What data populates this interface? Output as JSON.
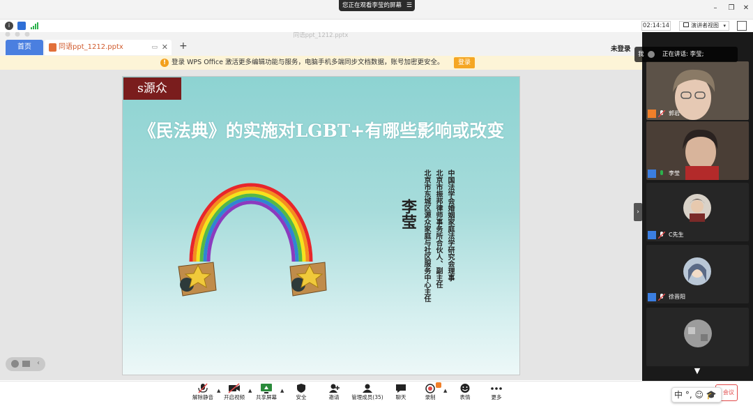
{
  "meeting": {
    "share_banner": "您正在观看李莹的屏幕",
    "timer": "02:14:14",
    "view_mode": "演讲者视图"
  },
  "wps": {
    "home_tab": "首页",
    "file_tab": "同语ppt_1212.pptx",
    "window_title": "同语ppt_1212.pptx",
    "new_tab": "+",
    "login_status": "未登录",
    "notice": "登录 WPS Office 激活更多编辑功能与服务，电脑手机多端同步文档数据，账号加密更安全。",
    "login_button": "登录"
  },
  "slide": {
    "logo": "ꜱ源众",
    "title": "《民法典》的实施对LGBT+有哪些影响或改变",
    "speaker": "李莹",
    "credentials": [
      "中国法学会婚姻家庭法学研究会理事",
      "北京市振邦律师事务所合伙人、副主任",
      "北京市东城区源众家庭与社区服务中心主任"
    ]
  },
  "panel": {
    "speaking_label": "我",
    "speaking_text": "正在讲话: 李莹;",
    "participants": [
      {
        "name": "郭岩"
      },
      {
        "name": "李莹"
      },
      {
        "name": "C先生"
      },
      {
        "name": "徐晋阳"
      }
    ]
  },
  "toolbar": {
    "items": [
      {
        "label": "解除静音",
        "icon": "mic-muted-icon"
      },
      {
        "label": "开启视频",
        "icon": "video-off-icon"
      },
      {
        "label": "共享屏幕",
        "icon": "share-screen-icon"
      },
      {
        "label": "安全",
        "icon": "shield-icon"
      },
      {
        "label": "邀请",
        "icon": "invite-icon"
      },
      {
        "label": "管理成员(35)",
        "icon": "members-icon"
      },
      {
        "label": "聊天",
        "icon": "chat-icon"
      },
      {
        "label": "录制",
        "icon": "record-icon"
      },
      {
        "label": "表情",
        "icon": "emoji-icon"
      },
      {
        "label": "更多",
        "icon": "more-icon"
      }
    ],
    "end_button": "会议",
    "ime": "中 °, ☺ 🎓"
  },
  "colors": {
    "accent": "#4a7fe0",
    "notice_bg": "#fdf4d7",
    "login_button": "#f5a623",
    "slide_bg": "#8dd3d2",
    "logo_bg": "#7a1d1d",
    "panel_bg": "#1a1a1a"
  }
}
